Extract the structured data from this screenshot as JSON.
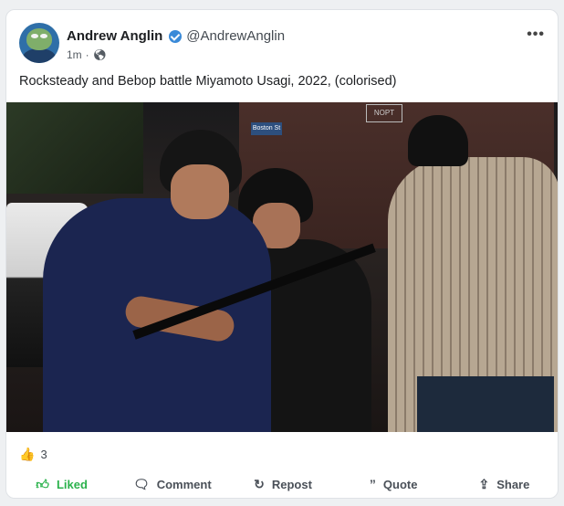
{
  "post": {
    "author_name": "Andrew Anglin",
    "author_handle": "@AndrewAnglin",
    "time_ago": "1m",
    "separator": "·",
    "text": "Rocksteady and Bebop battle Miyamoto Usagi, 2022, (colorised)"
  },
  "photo": {
    "street_sign": "Boston St",
    "wall_sign": "NOPT"
  },
  "reactions": {
    "count": "3"
  },
  "actions": [
    {
      "label": "Liked",
      "icon": "thumb-up-icon",
      "active": true
    },
    {
      "label": "Comment",
      "icon": "comment-icon",
      "active": false
    },
    {
      "label": "Repost",
      "icon": "repost-icon",
      "active": false
    },
    {
      "label": "Quote",
      "icon": "quote-icon",
      "active": false
    },
    {
      "label": "Share",
      "icon": "share-icon",
      "active": false
    }
  ],
  "colors": {
    "liked": "#2bb24c",
    "verified": "#3a8ad8"
  }
}
